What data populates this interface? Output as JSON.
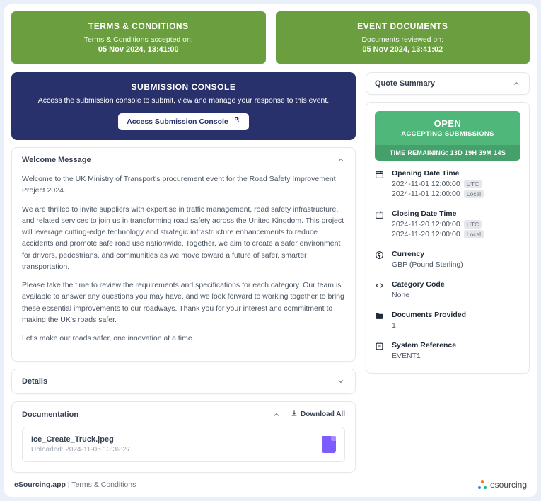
{
  "terms": {
    "title": "TERMS & CONDITIONS",
    "sub": "Terms & Conditions accepted on:",
    "date": "05 Nov 2024, 13:41:00"
  },
  "docs": {
    "title": "EVENT DOCUMENTS",
    "sub": "Documents reviewed on:",
    "date": "05 Nov 2024, 13:41:02"
  },
  "submission": {
    "title": "SUBMISSION CONSOLE",
    "desc": "Access the submission console to submit, view and manage your response to this event.",
    "btn": "Access Submission Console"
  },
  "welcome": {
    "title": "Welcome Message",
    "p1": "Welcome to the UK Ministry of Transport's procurement event for the Road Safety Improvement Project 2024.",
    "p2": "We are thrilled to invite suppliers with expertise in traffic management, road safety infrastructure, and related services to join us in transforming road safety across the United Kingdom. This project will leverage cutting-edge technology and strategic infrastructure enhancements to reduce accidents and promote safe road use nationwide. Together, we aim to create a safer environment for drivers, pedestrians, and communities as we move toward a future of safer, smarter transportation.",
    "p3": "Please take the time to review the requirements and specifications for each category. Our team is available to answer any questions you may have, and we look forward to working together to bring these essential improvements to our roadways. Thank you for your interest and commitment to making the UK's roads safer.",
    "p4": "Let's make our roads safer, one innovation at a time."
  },
  "details": {
    "title": "Details"
  },
  "documentation": {
    "title": "Documentation",
    "download_all": "Download All",
    "file_name": "Ice_Create_Truck.jpeg",
    "file_uploaded": "Uploaded: 2024-11-05 13:39:27"
  },
  "summary": {
    "title": "Quote Summary",
    "status": "OPEN",
    "status_sub": "ACCEPTING SUBMISSIONS",
    "time_remaining": "TIME REMAINING: 13D 19H 39M 14S",
    "opening": {
      "label": "Opening Date Time",
      "utc": "2024-11-01 12:00:00",
      "local": "2024-11-01 12:00:00"
    },
    "closing": {
      "label": "Closing Date Time",
      "utc": "2024-11-20 12:00:00",
      "local": "2024-11-20 12:00:00"
    },
    "currency": {
      "label": "Currency",
      "value": "GBP (Pound Sterling)"
    },
    "category": {
      "label": "Category Code",
      "value": "None"
    },
    "docs": {
      "label": "Documents Provided",
      "value": "1"
    },
    "ref": {
      "label": "System Reference",
      "value": "EVENT1"
    },
    "tags": {
      "utc": "UTC",
      "local": "Local"
    }
  },
  "footer": {
    "app": "eSourcing.app",
    "link": "Terms & Conditions",
    "brand": "esourcing"
  }
}
